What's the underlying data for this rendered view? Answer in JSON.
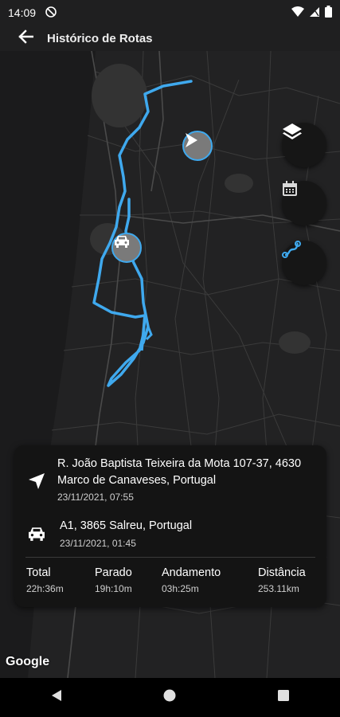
{
  "status_bar": {
    "time": "14:09",
    "icons": [
      "do-not-disturb-icon",
      "wifi-icon",
      "signal-icon",
      "battery-icon"
    ]
  },
  "app_bar": {
    "title": "Histórico de Rotas",
    "back_icon": "arrow-back-icon"
  },
  "map": {
    "route_color": "#3fa9ee",
    "buttons": [
      "layers-icon",
      "calendar-icon",
      "route-icon"
    ],
    "attribution": "Google"
  },
  "route_card": {
    "start": {
      "address": "R. João Baptista Teixeira da Mota 107-37, 4630 Marco de Canaveses, Portugal",
      "datetime": "23/11/2021, 07:55",
      "icon": "navigation-arrow-icon"
    },
    "end": {
      "address": "A1, 3865 Salreu, Portugal",
      "datetime": "23/11/2021, 01:45",
      "icon": "car-icon"
    },
    "stats": {
      "total": {
        "label": "Total",
        "value": "22h:36m"
      },
      "parado": {
        "label": "Parado",
        "value": "19h:10m"
      },
      "andamento": {
        "label": "Andamento",
        "value": "03h:25m"
      },
      "distancia": {
        "label": "Distância",
        "value": "253.11km"
      }
    }
  },
  "nav_bar": {
    "icons": [
      "back-triangle-icon",
      "home-circle-icon",
      "recents-square-icon"
    ]
  }
}
